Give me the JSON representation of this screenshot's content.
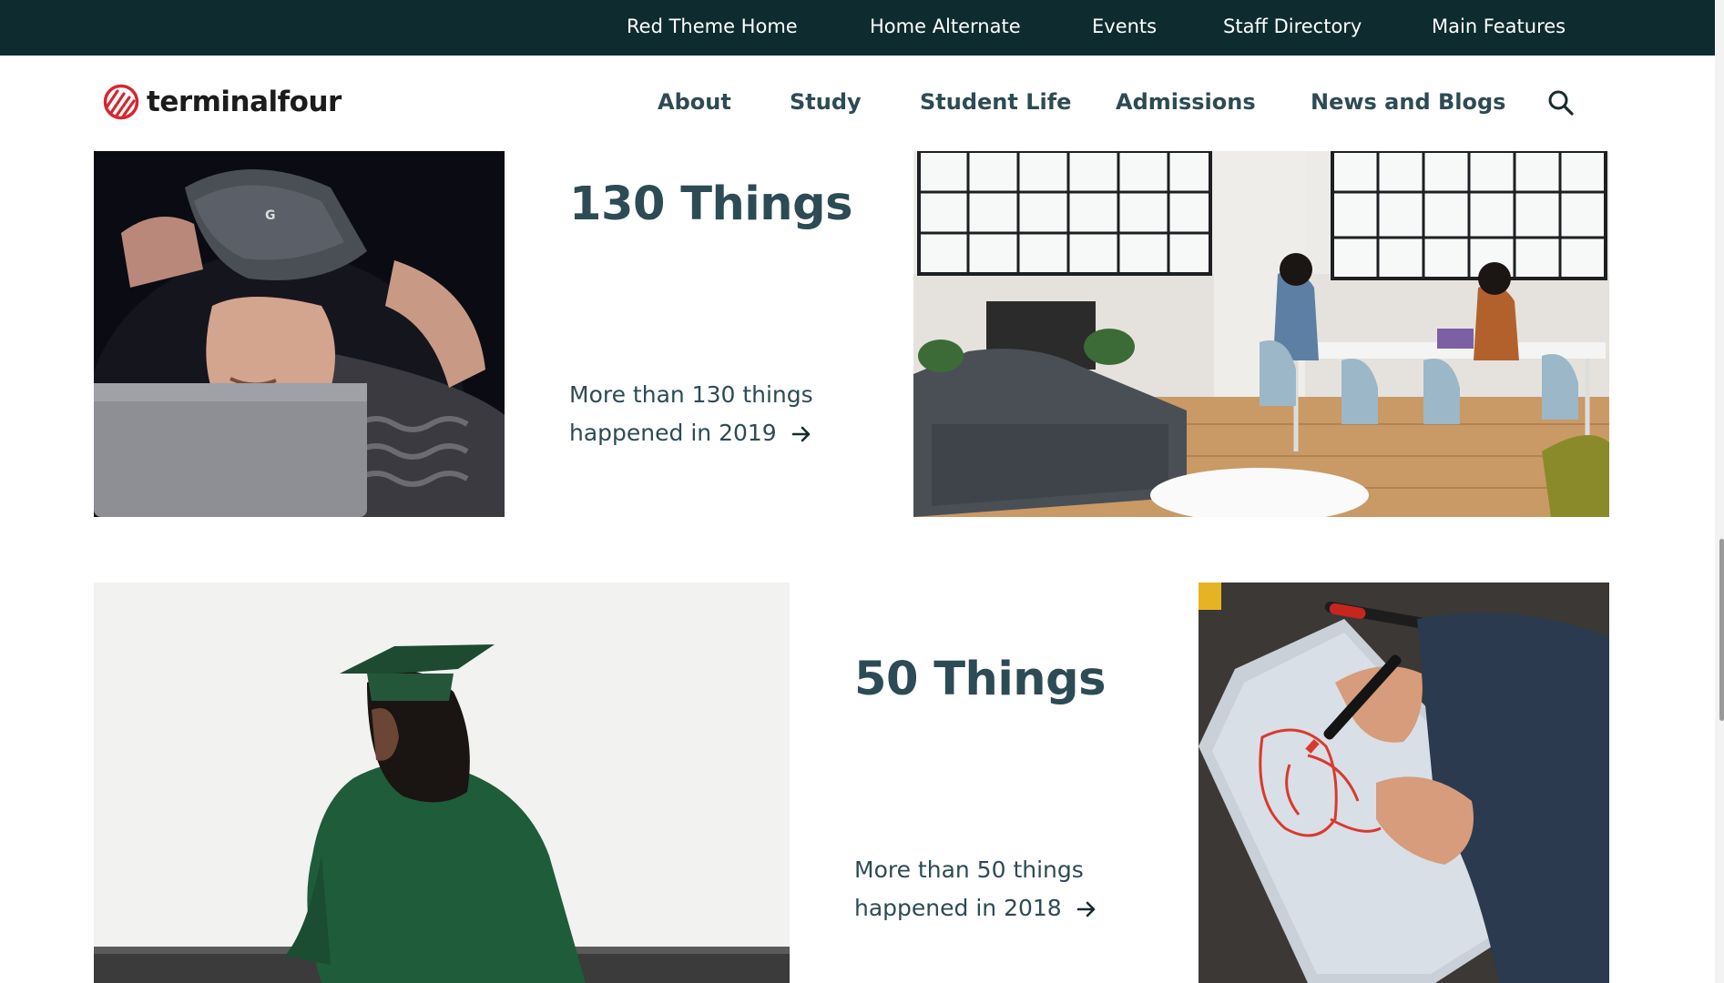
{
  "utility_nav": [
    {
      "label": "Red Theme Home"
    },
    {
      "label": "Home Alternate"
    },
    {
      "label": "Events"
    },
    {
      "label": "Staff Directory"
    },
    {
      "label": "Main Features"
    }
  ],
  "header": {
    "logo_text": "terminalfour",
    "nav": [
      {
        "label": "About"
      },
      {
        "label": "Study"
      },
      {
        "label": "Student Life"
      },
      {
        "label": "Admissions"
      },
      {
        "label": "News and Blogs"
      }
    ],
    "search_icon": "search-icon"
  },
  "cards": [
    {
      "title": "130 Things",
      "link_line1": "More than 130 things",
      "link_line2": "happened in 2019"
    },
    {
      "title": "50 Things",
      "link_line1": "More than 50 things",
      "link_line2": "happened in 2018"
    }
  ],
  "colors": {
    "utility_bar": "#0e2b2f",
    "heading": "#2d4b54",
    "brand_red": "#d7262f"
  }
}
